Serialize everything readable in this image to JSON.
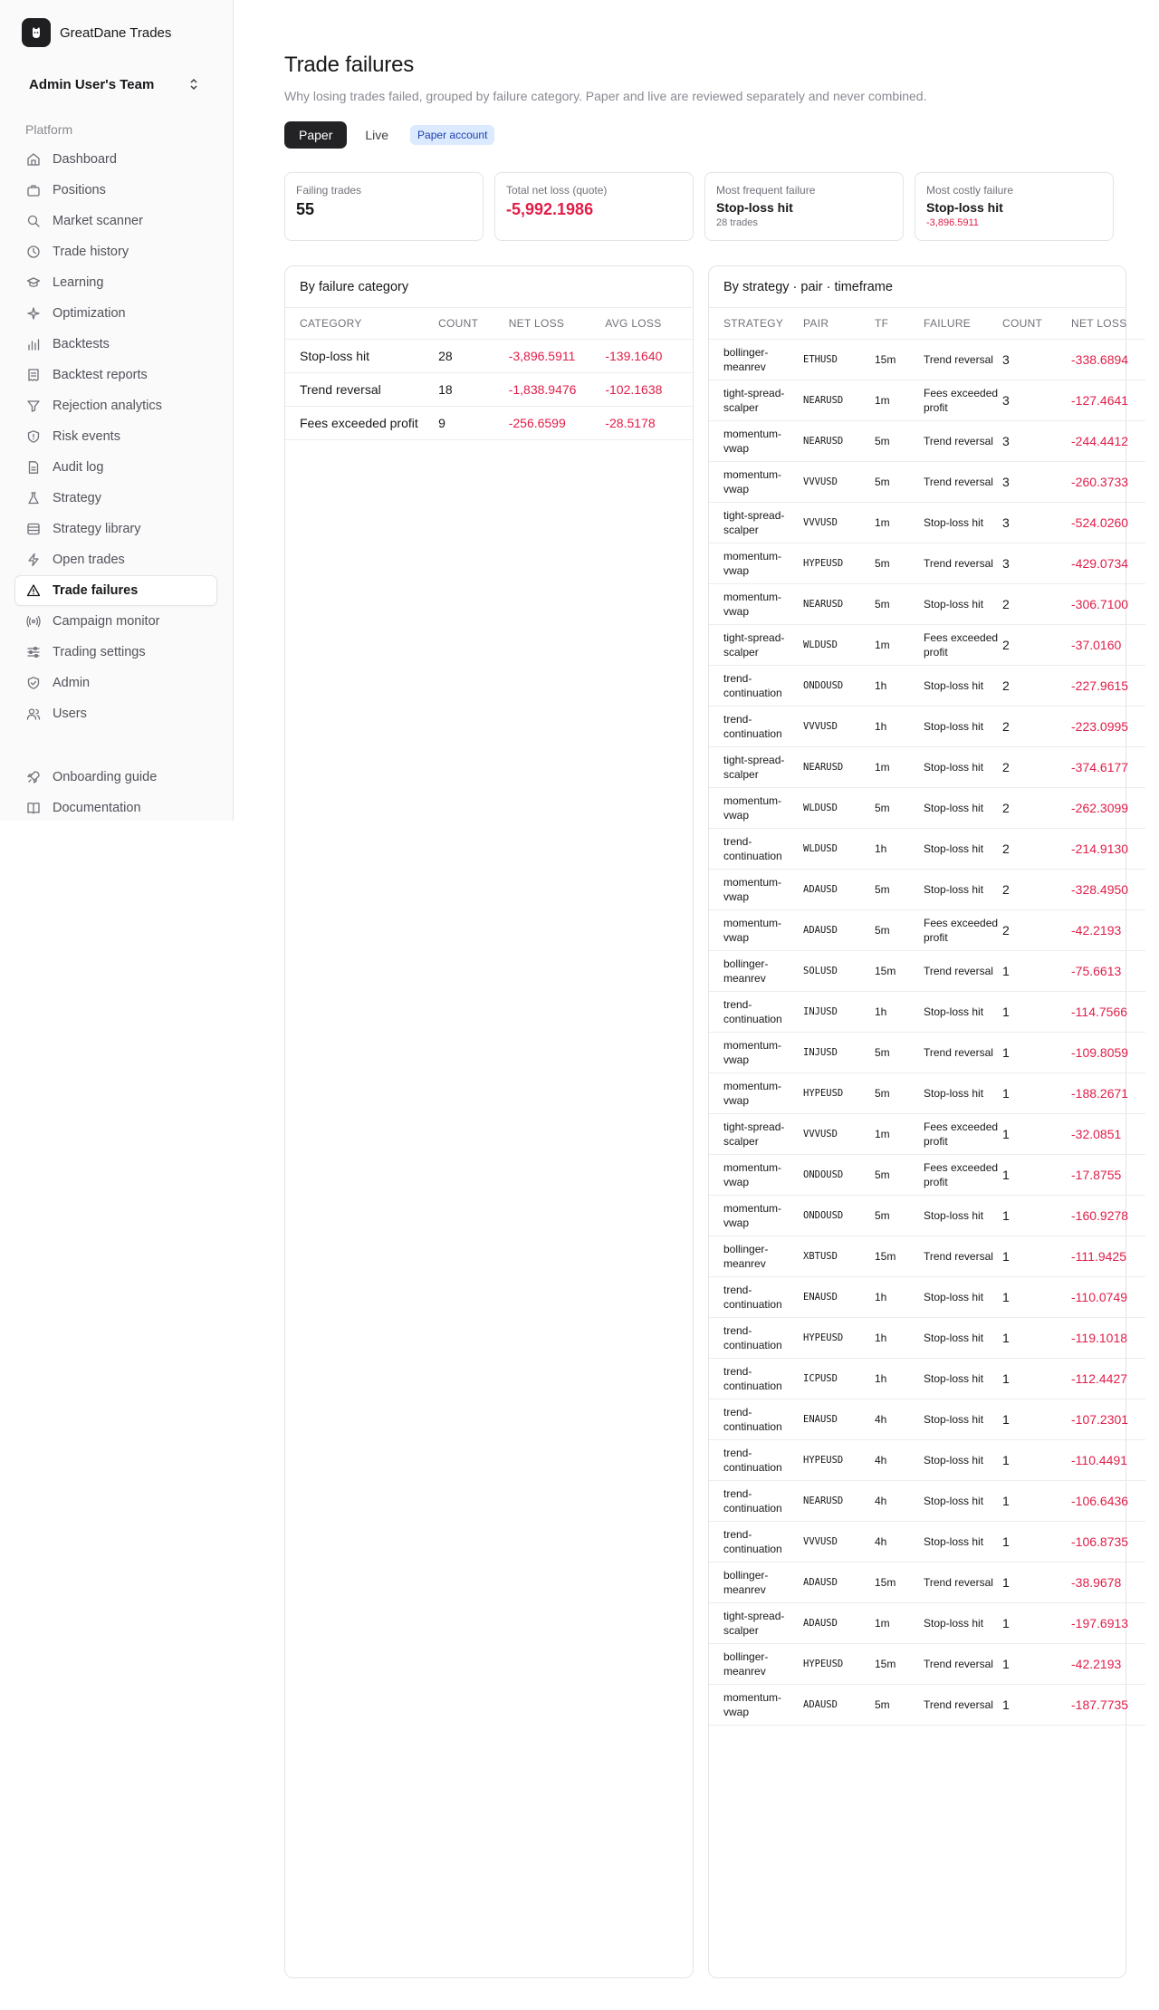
{
  "brand": {
    "name": "GreatDane Trades"
  },
  "team": {
    "name": "Admin User's Team"
  },
  "sidebar": {
    "section": "Platform",
    "items": [
      {
        "label": "Dashboard",
        "icon": "home-icon"
      },
      {
        "label": "Positions",
        "icon": "briefcase-icon"
      },
      {
        "label": "Market scanner",
        "icon": "search-icon"
      },
      {
        "label": "Trade history",
        "icon": "history-icon"
      },
      {
        "label": "Learning",
        "icon": "graduation-cap-icon"
      },
      {
        "label": "Optimization",
        "icon": "sparkles-icon"
      },
      {
        "label": "Backtests",
        "icon": "bar-chart-icon"
      },
      {
        "label": "Backtest reports",
        "icon": "receipt-icon"
      },
      {
        "label": "Rejection analytics",
        "icon": "filter-icon"
      },
      {
        "label": "Risk events",
        "icon": "shield-alert-icon"
      },
      {
        "label": "Audit log",
        "icon": "file-text-icon"
      },
      {
        "label": "Strategy",
        "icon": "flask-icon"
      },
      {
        "label": "Strategy library",
        "icon": "library-icon"
      },
      {
        "label": "Open trades",
        "icon": "zap-icon"
      },
      {
        "label": "Trade failures",
        "icon": "alert-triangle-icon",
        "active": true
      },
      {
        "label": "Campaign monitor",
        "icon": "radio-icon"
      },
      {
        "label": "Trading settings",
        "icon": "sliders-icon"
      },
      {
        "label": "Admin",
        "icon": "shield-check-icon"
      },
      {
        "label": "Users",
        "icon": "users-icon"
      }
    ],
    "bottom": [
      {
        "label": "Onboarding guide",
        "icon": "rocket-icon"
      },
      {
        "label": "Documentation",
        "icon": "book-icon"
      }
    ]
  },
  "page": {
    "title": "Trade failures",
    "subtitle": "Why losing trades failed, grouped by failure category. Paper and live are reviewed separately and never combined.",
    "tabs": [
      "Paper",
      "Live"
    ],
    "badge": "Paper account"
  },
  "stats": [
    {
      "label": "Failing trades",
      "value": "55"
    },
    {
      "label": "Total net loss (quote)",
      "value": "-5,992.1986"
    },
    {
      "label": "Most frequent failure",
      "value": "Stop-loss hit",
      "note": "28 trades"
    },
    {
      "label": "Most costly failure",
      "value": "Stop-loss hit",
      "note": "-3,896.5911"
    }
  ],
  "by_category": {
    "title": "By failure category",
    "headers": [
      "CATEGORY",
      "COUNT",
      "NET LOSS",
      "AVG LOSS"
    ],
    "rows": [
      [
        "Stop-loss hit",
        "28",
        "-3,896.5911",
        "-139.1640"
      ],
      [
        "Trend reversal",
        "18",
        "-1,838.9476",
        "-102.1638"
      ],
      [
        "Fees exceeded profit",
        "9",
        "-256.6599",
        "-28.5178"
      ]
    ]
  },
  "by_strategy": {
    "title": "By strategy · pair · timeframe",
    "headers": [
      "STRATEGY",
      "PAIR",
      "TF",
      "FAILURE",
      "COUNT",
      "NET LOSS"
    ],
    "rows": [
      [
        "bollinger-meanrev",
        "ETHUSD",
        "15m",
        "Trend reversal",
        "3",
        "-338.6894"
      ],
      [
        "tight-spread-scalper",
        "NEARUSD",
        "1m",
        "Fees exceeded profit",
        "3",
        "-127.4641"
      ],
      [
        "momentum-vwap",
        "NEARUSD",
        "5m",
        "Trend reversal",
        "3",
        "-244.4412"
      ],
      [
        "momentum-vwap",
        "VVVUSD",
        "5m",
        "Trend reversal",
        "3",
        "-260.3733"
      ],
      [
        "tight-spread-scalper",
        "VVVUSD",
        "1m",
        "Stop-loss hit",
        "3",
        "-524.0260"
      ],
      [
        "momentum-vwap",
        "HYPEUSD",
        "5m",
        "Trend reversal",
        "3",
        "-429.0734"
      ],
      [
        "momentum-vwap",
        "NEARUSD",
        "5m",
        "Stop-loss hit",
        "2",
        "-306.7100"
      ],
      [
        "tight-spread-scalper",
        "WLDUSD",
        "1m",
        "Fees exceeded profit",
        "2",
        "-37.0160"
      ],
      [
        "trend-continuation",
        "ONDOUSD",
        "1h",
        "Stop-loss hit",
        "2",
        "-227.9615"
      ],
      [
        "trend-continuation",
        "VVVUSD",
        "1h",
        "Stop-loss hit",
        "2",
        "-223.0995"
      ],
      [
        "tight-spread-scalper",
        "NEARUSD",
        "1m",
        "Stop-loss hit",
        "2",
        "-374.6177"
      ],
      [
        "momentum-vwap",
        "WLDUSD",
        "5m",
        "Stop-loss hit",
        "2",
        "-262.3099"
      ],
      [
        "trend-continuation",
        "WLDUSD",
        "1h",
        "Stop-loss hit",
        "2",
        "-214.9130"
      ],
      [
        "momentum-vwap",
        "ADAUSD",
        "5m",
        "Stop-loss hit",
        "2",
        "-328.4950"
      ],
      [
        "momentum-vwap",
        "ADAUSD",
        "5m",
        "Fees exceeded profit",
        "2",
        "-42.2193"
      ],
      [
        "bollinger-meanrev",
        "SOLUSD",
        "15m",
        "Trend reversal",
        "1",
        "-75.6613"
      ],
      [
        "trend-continuation",
        "INJUSD",
        "1h",
        "Stop-loss hit",
        "1",
        "-114.7566"
      ],
      [
        "momentum-vwap",
        "INJUSD",
        "5m",
        "Trend reversal",
        "1",
        "-109.8059"
      ],
      [
        "momentum-vwap",
        "HYPEUSD",
        "5m",
        "Stop-loss hit",
        "1",
        "-188.2671"
      ],
      [
        "tight-spread-scalper",
        "VVVUSD",
        "1m",
        "Fees exceeded profit",
        "1",
        "-32.0851"
      ],
      [
        "momentum-vwap",
        "ONDOUSD",
        "5m",
        "Fees exceeded profit",
        "1",
        "-17.8755"
      ],
      [
        "momentum-vwap",
        "ONDOUSD",
        "5m",
        "Stop-loss hit",
        "1",
        "-160.9278"
      ],
      [
        "bollinger-meanrev",
        "XBTUSD",
        "15m",
        "Trend reversal",
        "1",
        "-111.9425"
      ],
      [
        "trend-continuation",
        "ENAUSD",
        "1h",
        "Stop-loss hit",
        "1",
        "-110.0749"
      ],
      [
        "trend-continuation",
        "HYPEUSD",
        "1h",
        "Stop-loss hit",
        "1",
        "-119.1018"
      ],
      [
        "trend-continuation",
        "ICPUSD",
        "1h",
        "Stop-loss hit",
        "1",
        "-112.4427"
      ],
      [
        "trend-continuation",
        "ENAUSD",
        "4h",
        "Stop-loss hit",
        "1",
        "-107.2301"
      ],
      [
        "trend-continuation",
        "HYPEUSD",
        "4h",
        "Stop-loss hit",
        "1",
        "-110.4491"
      ],
      [
        "trend-continuation",
        "NEARUSD",
        "4h",
        "Stop-loss hit",
        "1",
        "-106.6436"
      ],
      [
        "trend-continuation",
        "VVVUSD",
        "4h",
        "Stop-loss hit",
        "1",
        "-106.8735"
      ],
      [
        "bollinger-meanrev",
        "ADAUSD",
        "15m",
        "Trend reversal",
        "1",
        "-38.9678"
      ],
      [
        "tight-spread-scalper",
        "ADAUSD",
        "1m",
        "Stop-loss hit",
        "1",
        "-197.6913"
      ],
      [
        "bollinger-meanrev",
        "HYPEUSD",
        "15m",
        "Trend reversal",
        "1",
        "-42.2193"
      ],
      [
        "momentum-vwap",
        "ADAUSD",
        "5m",
        "Trend reversal",
        "1",
        "-187.7735"
      ]
    ]
  },
  "colors": {
    "negative": "#e11d48",
    "active_tab": "#232326",
    "badge_bg": "#dbeafe"
  }
}
